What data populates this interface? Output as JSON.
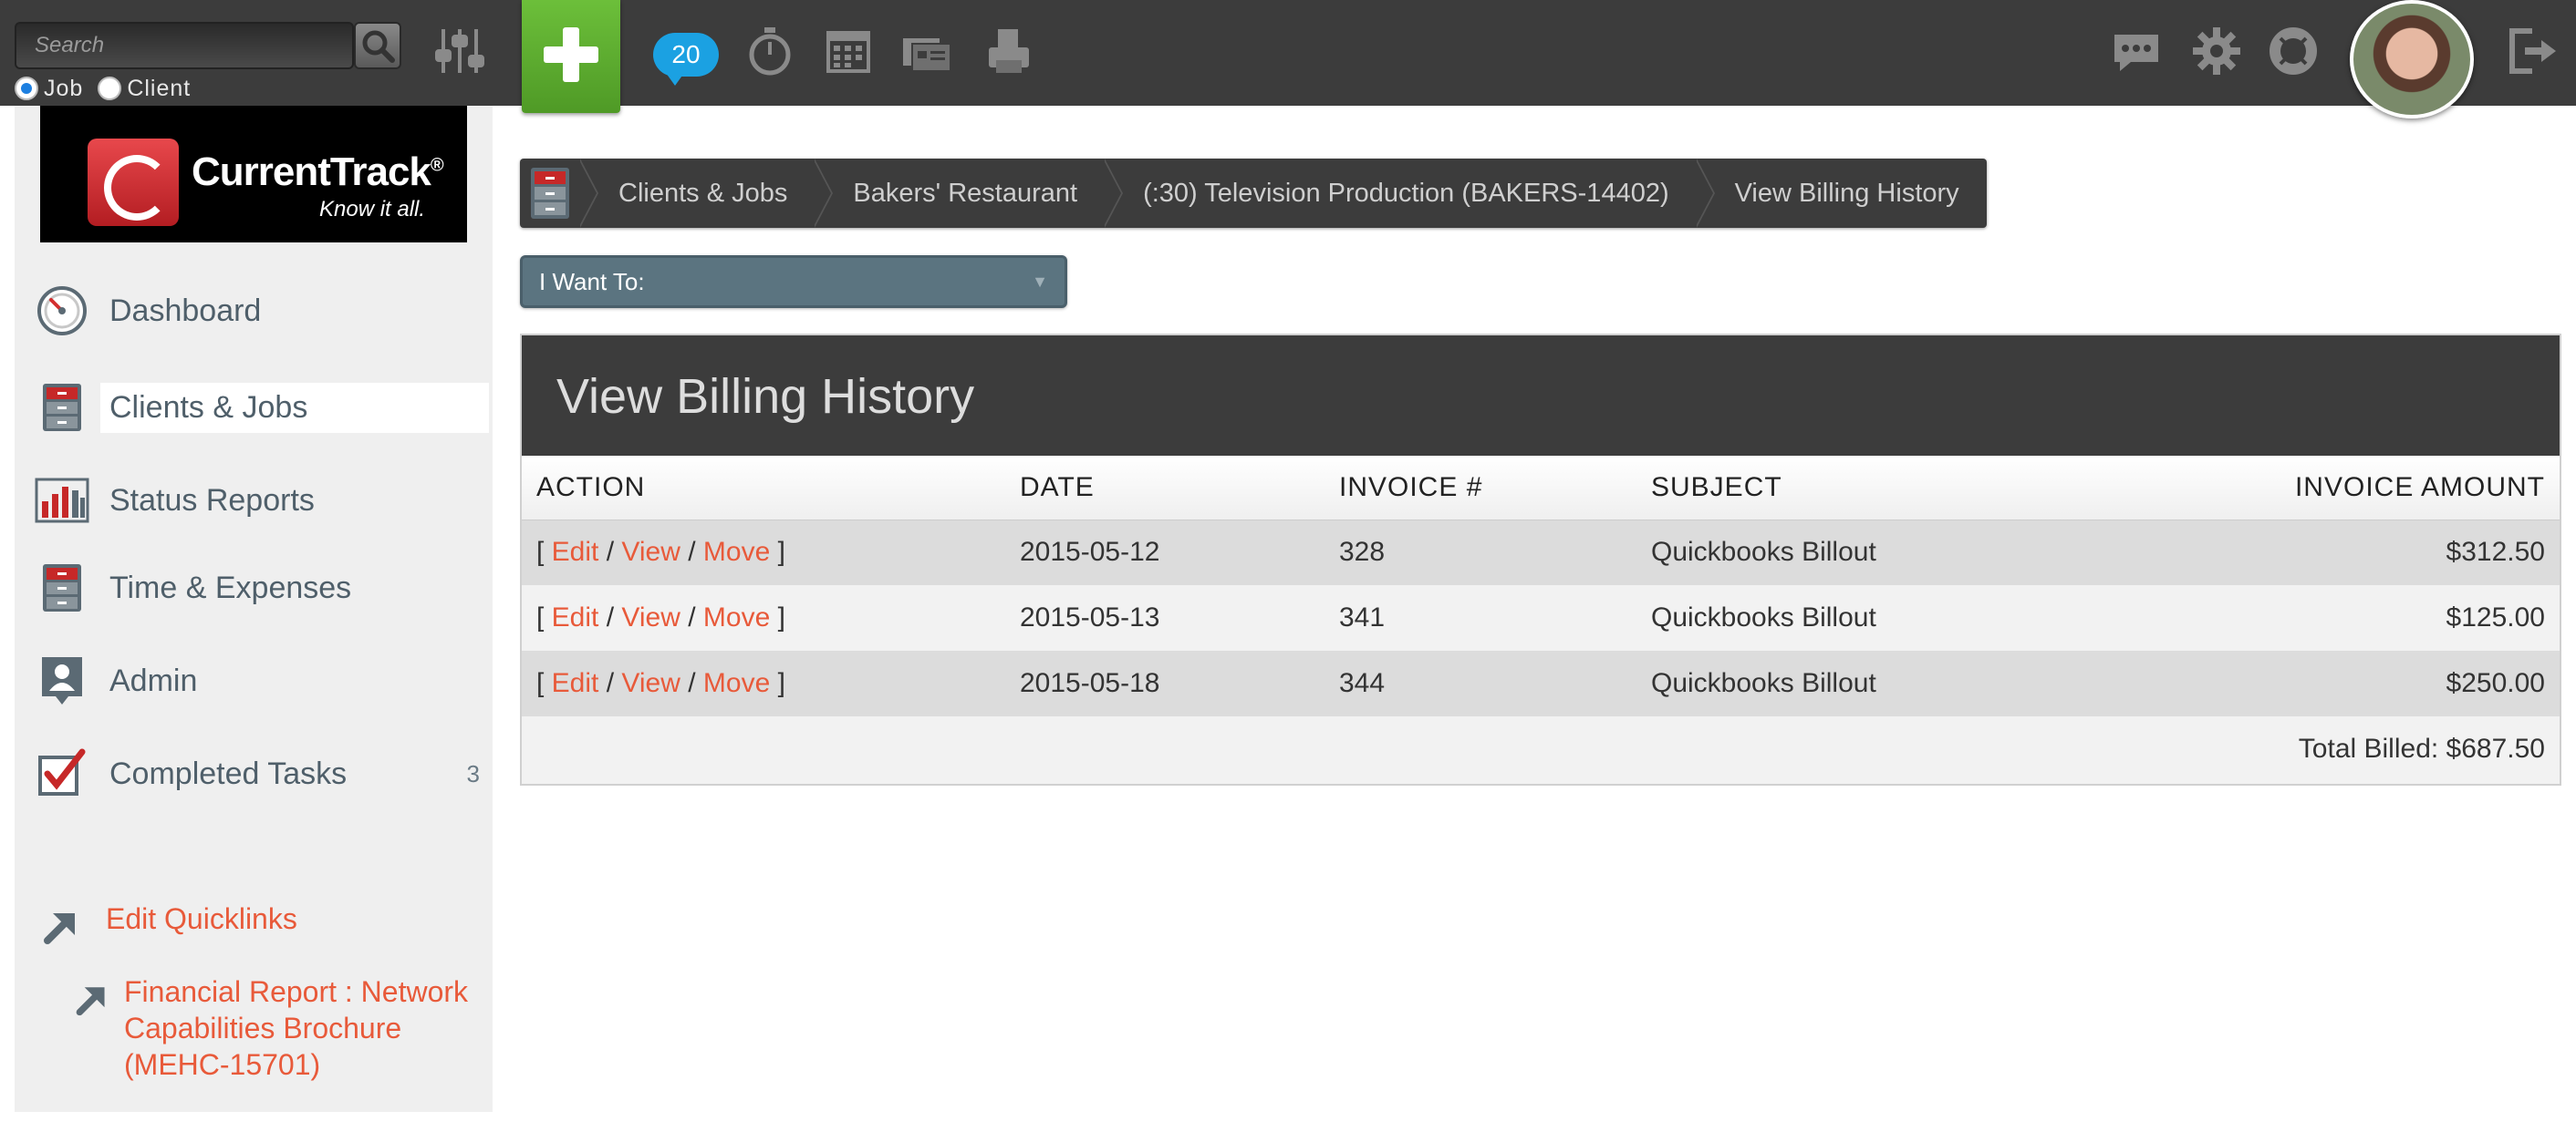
{
  "topbar": {
    "search_placeholder": "Search",
    "radio_job": "Job",
    "radio_client": "Client",
    "message_count": "20"
  },
  "logo": {
    "name": "CurrentTrack",
    "registered": "®",
    "tagline": "Know it all."
  },
  "sidebar": {
    "items": [
      {
        "label": "Dashboard"
      },
      {
        "label": "Clients & Jobs"
      },
      {
        "label": "Status Reports"
      },
      {
        "label": "Time & Expenses"
      },
      {
        "label": "Admin"
      },
      {
        "label": "Completed Tasks",
        "count": "3"
      }
    ],
    "quicklinks_edit": "Edit Quicklinks",
    "quicklink_1": "Financial Report : Network Capabilities Brochure (MEHC-15701)"
  },
  "breadcrumb": {
    "items": [
      "Clients & Jobs",
      "Bakers' Restaurant",
      "(:30) Television Production (BAKERS-14402)",
      "View Billing History"
    ]
  },
  "want_to": {
    "label": "I Want To:"
  },
  "billing": {
    "title": "View Billing History",
    "columns": [
      "ACTION",
      "DATE",
      "INVOICE #",
      "SUBJECT",
      "INVOICE AMOUNT"
    ],
    "action_edit": "Edit",
    "action_view": "View",
    "action_move": "Move",
    "rows": [
      {
        "date": "2015-05-12",
        "invoice": "328",
        "subject": "Quickbooks Billout",
        "amount": "$312.50"
      },
      {
        "date": "2015-05-13",
        "invoice": "341",
        "subject": "Quickbooks Billout",
        "amount": "$125.00"
      },
      {
        "date": "2015-05-18",
        "invoice": "344",
        "subject": "Quickbooks Billout",
        "amount": "$250.00"
      }
    ],
    "total": "Total Billed: $687.50"
  },
  "colors": {
    "topbar": "#3c3c3c",
    "accent_green": "#5aab2f",
    "link_orange": "#e85a3a",
    "badge_blue": "#1ba1e2",
    "select_slate": "#5b7480"
  }
}
